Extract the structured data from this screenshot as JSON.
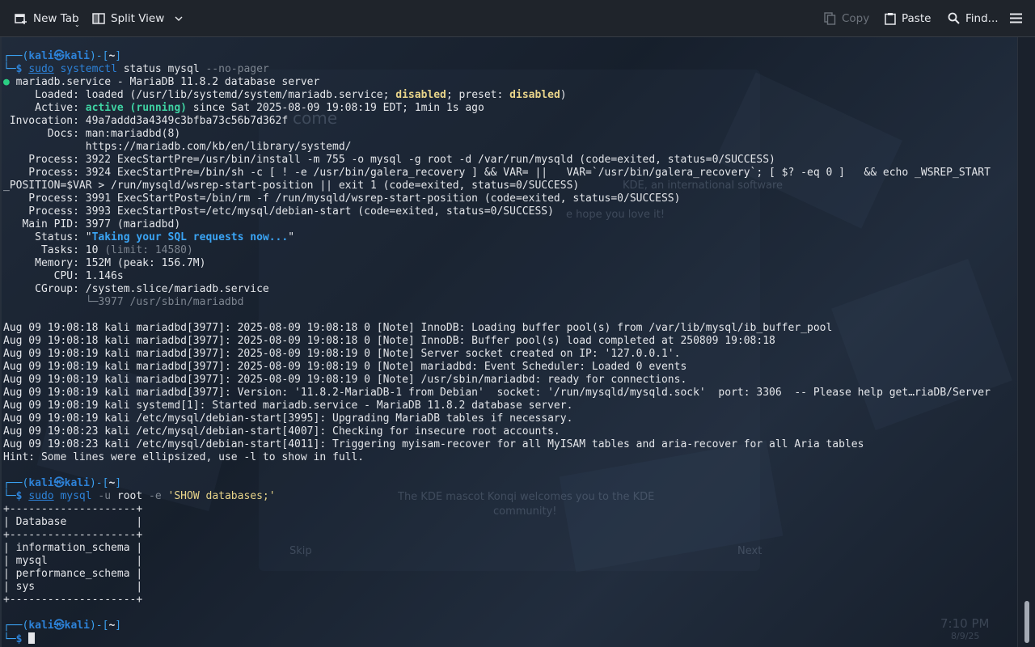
{
  "toolbar": {
    "new_tab": "New Tab",
    "split_view": "Split View",
    "copy": "Copy",
    "paste": "Paste",
    "find": "Find..."
  },
  "prompt": {
    "user": "kali",
    "host": "kali",
    "dir": "~",
    "symbol": "$"
  },
  "commands": {
    "c1_sudo": "sudo",
    "c1_prog": "systemctl",
    "c1_args": " status mysql ",
    "c1_flag": "--no-pager",
    "c2_sudo": "sudo",
    "c2_prog": "mysql",
    "c2_flag1": " -u",
    "c2_user": " root ",
    "c2_flag2": "-e",
    "c2_query": " 'SHOW databases;'"
  },
  "status": {
    "title": "mariadb.service - MariaDB 11.8.2 database server",
    "loaded_pre": "     Loaded: loaded (/usr/lib/systemd/system/mariadb.service; ",
    "disabled1": "disabled",
    "loaded_mid": "; preset: ",
    "disabled2": "disabled",
    "loaded_end": ")",
    "active_pre": "     Active: ",
    "active_state": "active (running)",
    "active_post": " since Sat 2025-08-09 19:08:19 EDT; 1min 1s ago",
    "invocation": " Invocation: 49a7addd3a4349c3bfba73c56b7d362f",
    "docs1": "       Docs: man:mariadbd(8)",
    "docs2": "             https://mariadb.com/kb/en/library/systemd/",
    "proc1": "    Process: 3922 ExecStartPre=/usr/bin/install -m 755 -o mysql -g root -d /var/run/mysqld (code=exited, status=0/SUCCESS)",
    "proc2a": "    Process: 3924 ExecStartPre=/bin/sh -c [ ! -e /usr/bin/galera_recovery ] && VAR= ||   VAR=`/usr/bin/galera_recovery`; [ $? -eq 0 ]   && echo _WSREP_START",
    "proc2b": "_POSITION=$VAR > /run/mysqld/wsrep-start-position || exit 1 (code=exited, status=0/SUCCESS)",
    "proc3": "    Process: 3991 ExecStartPost=/bin/rm -f /run/mysqld/wsrep-start-position (code=exited, status=0/SUCCESS)",
    "proc4": "    Process: 3993 ExecStartPost=/etc/mysql/debian-start (code=exited, status=0/SUCCESS)",
    "mainpid": "   Main PID: 3977 (mariadbd)",
    "status_pre": "     Status: \"",
    "status_msg": "Taking your SQL requests now...",
    "status_post": "\"",
    "tasks_pre": "      Tasks: 10 ",
    "tasks_limit": "(limit: 14580)",
    "memory": "     Memory: 152M (peak: 156.7M)",
    "cpu": "        CPU: 1.146s",
    "cgroup": "     CGroup: /system.slice/mariadb.service",
    "cgroup_child": "             └─3977 /usr/sbin/mariadbd"
  },
  "journal": [
    "Aug 09 19:08:18 kali mariadbd[3977]: 2025-08-09 19:08:18 0 [Note] InnoDB: Loading buffer pool(s) from /var/lib/mysql/ib_buffer_pool",
    "Aug 09 19:08:18 kali mariadbd[3977]: 2025-08-09 19:08:18 0 [Note] InnoDB: Buffer pool(s) load completed at 250809 19:08:18",
    "Aug 09 19:08:19 kali mariadbd[3977]: 2025-08-09 19:08:19 0 [Note] Server socket created on IP: '127.0.0.1'.",
    "Aug 09 19:08:19 kali mariadbd[3977]: 2025-08-09 19:08:19 0 [Note] mariadbd: Event Scheduler: Loaded 0 events",
    "Aug 09 19:08:19 kali mariadbd[3977]: 2025-08-09 19:08:19 0 [Note] /usr/sbin/mariadbd: ready for connections.",
    "Aug 09 19:08:19 kali mariadbd[3977]: Version: '11.8.2-MariaDB-1 from Debian'  socket: '/run/mysqld/mysqld.sock'  port: 3306  -- Please help get…riaDB/Server",
    "Aug 09 19:08:19 kali systemd[1]: Started mariadb.service - MariaDB 11.8.2 database server.",
    "Aug 09 19:08:19 kali /etc/mysql/debian-start[3995]: Upgrading MariaDB tables if necessary.",
    "Aug 09 19:08:23 kali /etc/mysql/debian-start[4007]: Checking for insecure root accounts.",
    "Aug 09 19:08:23 kali /etc/mysql/debian-start[4011]: Triggering myisam-recover for all MyISAM tables and aria-recover for all Aria tables",
    "Hint: Some lines were ellipsized, use -l to show in full."
  ],
  "db_table": {
    "border": "+--------------------+",
    "header": "| Database           |",
    "rows": [
      "| information_schema |",
      "| mysql              |",
      "| performance_schema |",
      "| sys                |"
    ]
  },
  "background": {
    "w1": "come",
    "w2": "KDE, an international software",
    "w3": "e hope you love it!",
    "w4": "The KDE mascot Konqi welcomes you to the KDE",
    "w5": "community!",
    "w6": "Skip",
    "w7": "Next",
    "clock_time": "7:10 PM",
    "clock_date": "8/9/25"
  }
}
